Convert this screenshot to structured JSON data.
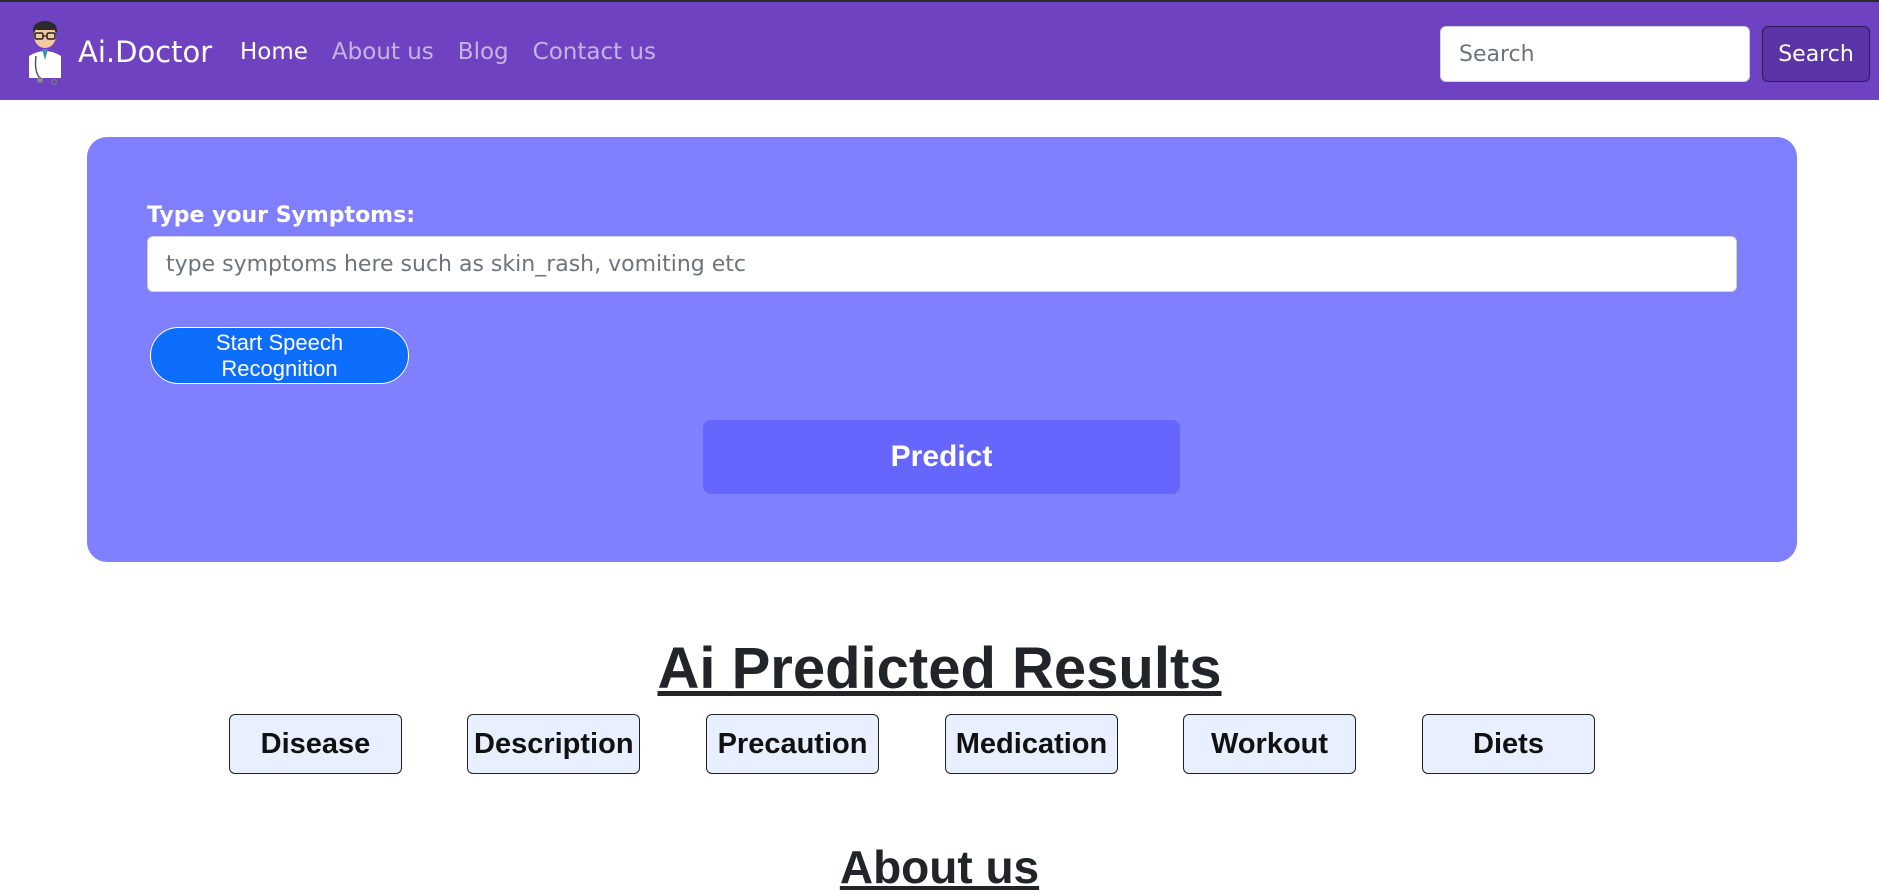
{
  "navbar": {
    "brand": "Ai.Doctor",
    "links": [
      {
        "label": "Home",
        "active": true
      },
      {
        "label": "About us",
        "active": false
      },
      {
        "label": "Blog",
        "active": false
      },
      {
        "label": "Contact us",
        "active": false
      }
    ],
    "search_placeholder": "Search",
    "search_button": "Search",
    "logo_icon": "doctor-avatar-icon"
  },
  "form": {
    "label": "Type your Symptoms:",
    "input_placeholder": "type symptoms here such as skin_rash, vomiting etc",
    "speech_button": "Start Speech Recognition",
    "predict_button": "Predict"
  },
  "results": {
    "title": "Ai Predicted Results",
    "buttons": [
      "Disease",
      "Description",
      "Precaution",
      "Medication",
      "Workout",
      "Diets"
    ]
  },
  "about": {
    "title": "About us"
  },
  "colors": {
    "navbar": "#6f42c1",
    "panel": "#8080ff",
    "predict": "#6666ff",
    "speech": "#0d6efd",
    "result_button_bg": "#e8efff"
  }
}
